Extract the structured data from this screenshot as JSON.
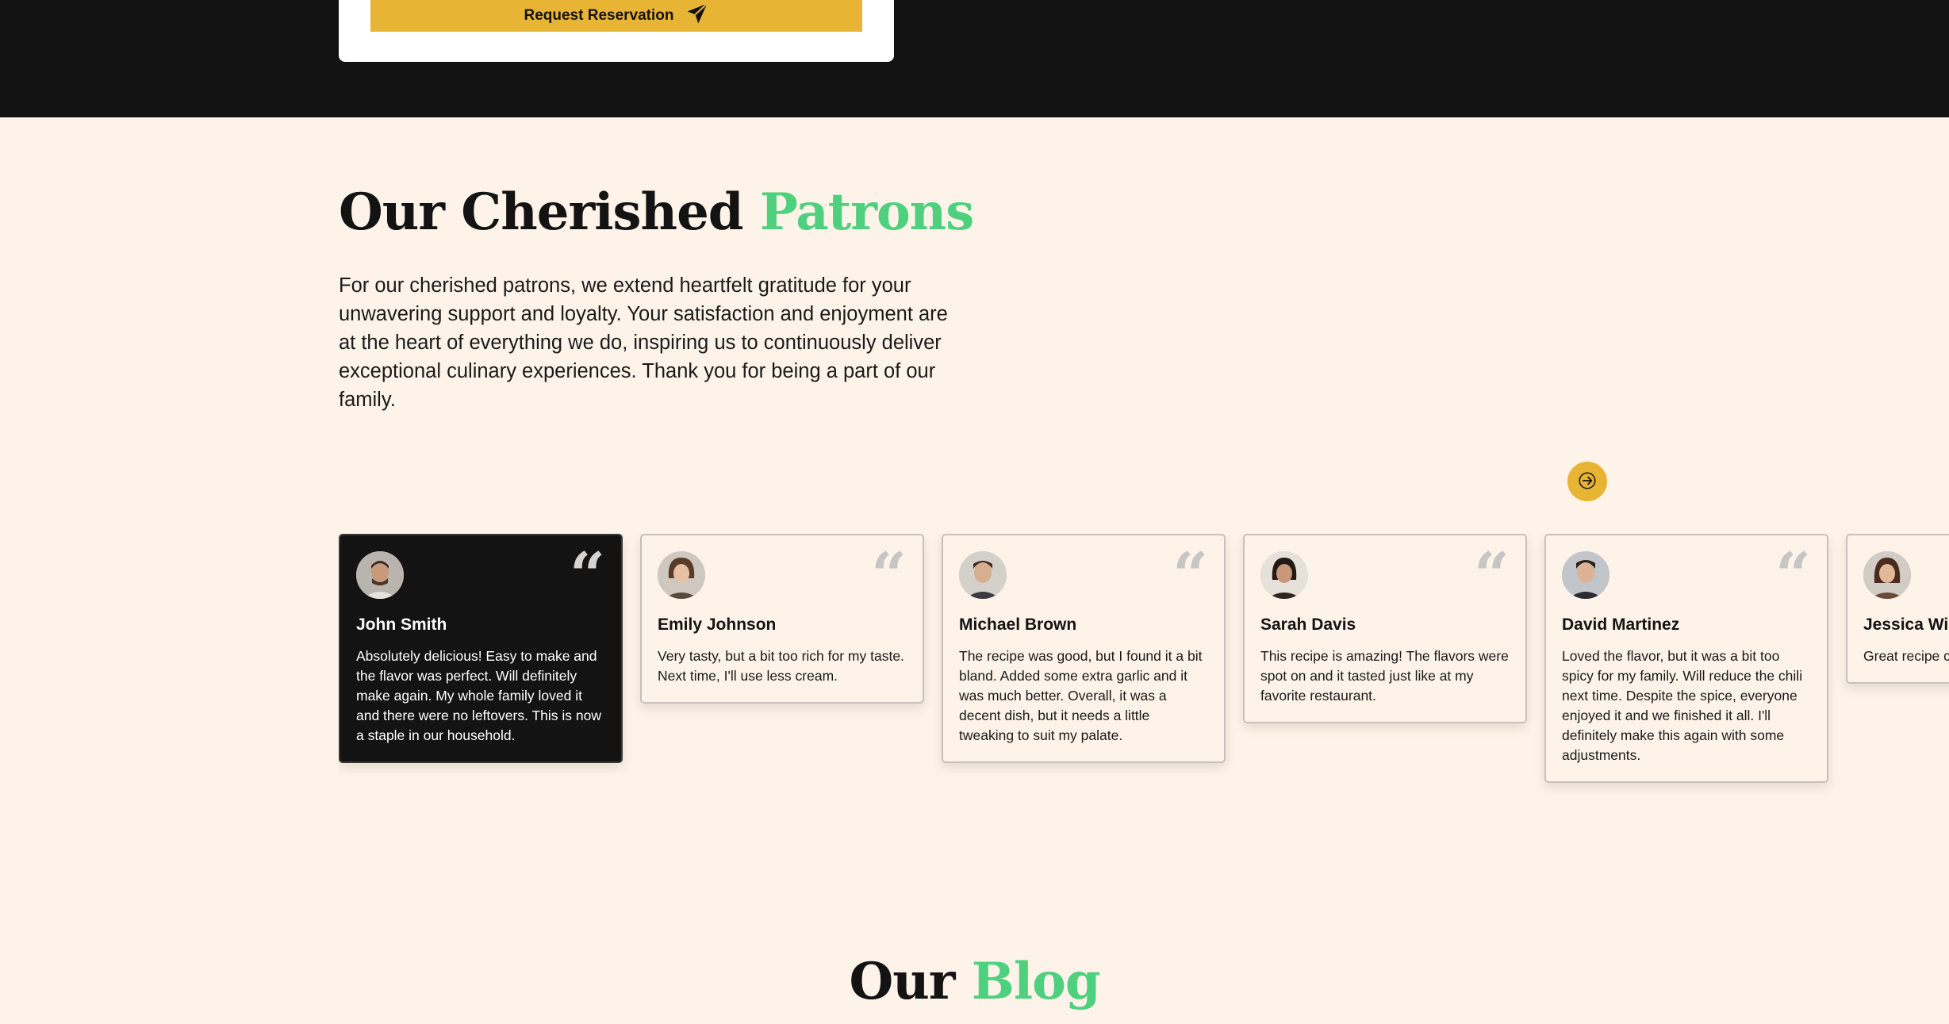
{
  "reservation": {
    "button_label": "Request Reservation",
    "icon": "paper-plane-icon"
  },
  "patrons": {
    "title_main": "Our Cherished",
    "title_accent": "Patrons",
    "intro": "For our cherished patrons, we extend heartfelt gratitude for your unwavering support and loyalty. Your satisfaction and enjoyment are at the heart of everything we do, inspiring us to continuously deliver exceptional culinary experiences. Thank you for being a part of our family.",
    "next_icon": "arrow-right-icon"
  },
  "reviews": [
    {
      "name": "John Smith",
      "text": "Absolutely delicious! Easy to make and the flavor was perfect. Will definitely make again. My whole family loved it and there were no leftovers. This is now a staple in our household.",
      "active": true
    },
    {
      "name": "Emily Johnson",
      "text": "Very tasty, but a bit too rich for my taste. Next time, I'll use less cream.",
      "active": false
    },
    {
      "name": "Michael Brown",
      "text": "The recipe was good, but I found it a bit bland. Added some extra garlic and it was much better. Overall, it was a decent dish, but it needs a little tweaking to suit my palate.",
      "active": false
    },
    {
      "name": "Sarah Davis",
      "text": "This recipe is amazing! The flavors were spot on and it tasted just like at my favorite restaurant.",
      "active": false
    },
    {
      "name": "David Martinez",
      "text": "Loved the flavor, but it was a bit too spicy for my family. Will reduce the chili next time. Despite the spice, everyone enjoyed it and we finished it all. I'll definitely make this again with some adjustments.",
      "active": false
    },
    {
      "name": "Jessica Wi",
      "text": "Great recipe cook than ex though!",
      "active": false
    }
  ],
  "quote_glyph": "“",
  "blog": {
    "title_main": "Our",
    "title_accent": "Blog"
  },
  "colors": {
    "accent_green": "#4fd07e",
    "brand_yellow": "#e8b434",
    "dark": "#141313",
    "cream": "#fdf3e8"
  }
}
